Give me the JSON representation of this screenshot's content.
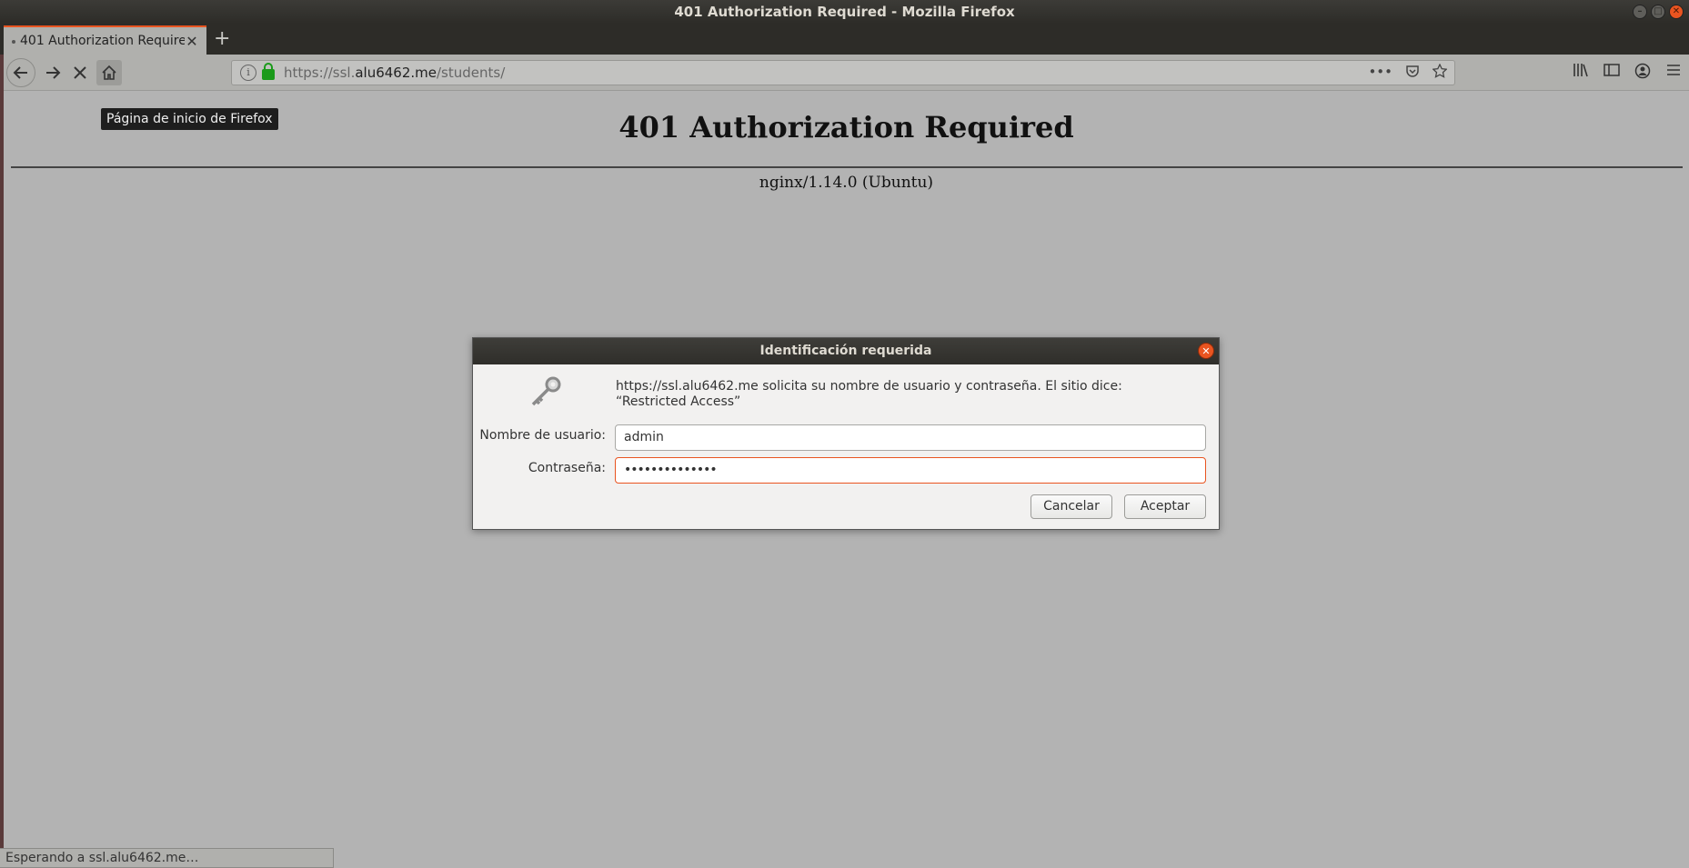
{
  "window": {
    "title": "401 Authorization Required - Mozilla Firefox"
  },
  "tabs": [
    {
      "label": "401 Authorization Required",
      "close_glyph": "✕"
    }
  ],
  "new_tab_glyph": "+",
  "nav": {
    "url_prefix": "https://ssl.",
    "url_domain": "alu6462.me",
    "url_path": "/students/"
  },
  "tooltip": "Página de inicio de Firefox",
  "page": {
    "heading": "401 Authorization Required",
    "server": "nginx/1.14.0 (Ubuntu)"
  },
  "dialog": {
    "title": "Identificación requerida",
    "message": "https://ssl.alu6462.me solicita su nombre de usuario y contraseña. El sitio dice: “Restricted Access”",
    "username_label": "Nombre de usuario:",
    "username_value": "admin",
    "password_label": "Contraseña:",
    "password_value": "••••••••••••••",
    "cancel_label": "Cancelar",
    "ok_label": "Aceptar"
  },
  "status": "Esperando a ssl.alu6462.me…",
  "colors": {
    "accent": "#e95420",
    "lock": "#1a9a1a"
  },
  "icons": [
    "back-icon",
    "forward-icon",
    "stop-icon",
    "home-icon",
    "info-icon",
    "lock-icon",
    "more-icon",
    "pocket-icon",
    "bookmark-star-icon",
    "library-icon",
    "sidebar-icon",
    "account-icon",
    "menu-icon",
    "key-icon"
  ]
}
